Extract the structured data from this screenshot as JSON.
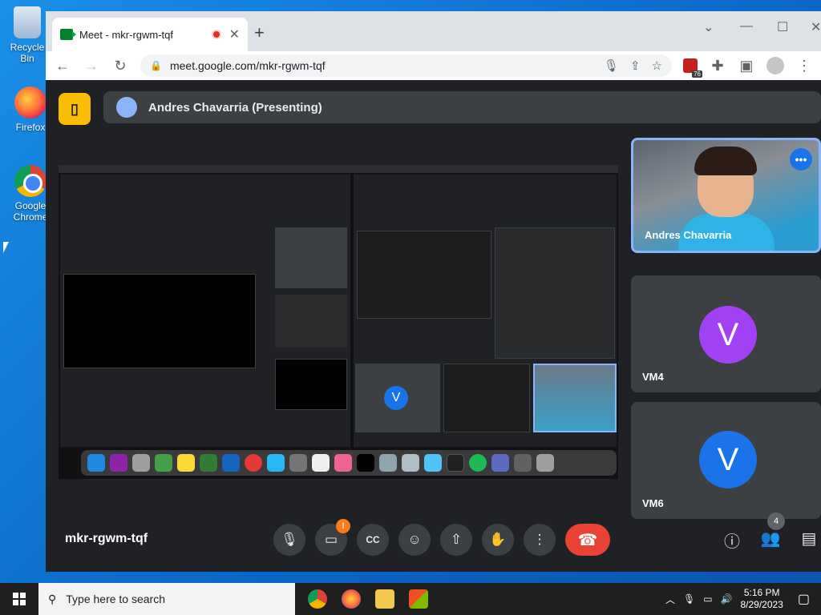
{
  "desktop": {
    "icons": [
      {
        "label": "Recycle Bin"
      },
      {
        "label": "Firefox"
      },
      {
        "label": "Google Chrome"
      }
    ]
  },
  "browser": {
    "tab_title": "Meet - mkr-rgwm-tqf",
    "url": "meet.google.com/mkr-rgwm-tqf",
    "extension_badge": "76"
  },
  "meet": {
    "presenter_label": "Andres Chavarria (Presenting)",
    "participants": [
      {
        "name": "Andres Chavarria",
        "type": "video"
      },
      {
        "name": "VM4",
        "initial": "V",
        "color": "#a142f4"
      },
      {
        "name": "VM6",
        "initial": "V",
        "color": "#1a73e8"
      }
    ],
    "meeting_code": "mkr-rgwm-tqf",
    "camera_warning": "!",
    "people_count": "4"
  },
  "taskbar": {
    "search_placeholder": "Type here to search",
    "time": "5:16 PM",
    "date": "8/29/2023"
  }
}
